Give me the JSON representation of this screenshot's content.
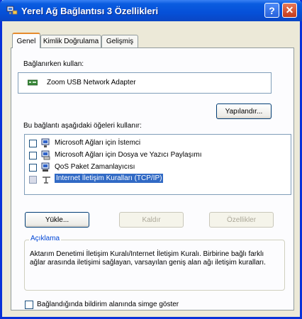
{
  "window": {
    "title": "Yerel Ağ Bağlantısı 3 Özellikleri",
    "help_label": "?",
    "close_label": "✕"
  },
  "tabs": [
    {
      "label": "Genel",
      "active": true
    },
    {
      "label": "Kimlik Doğrulama",
      "active": false
    },
    {
      "label": "Gelişmiş",
      "active": false
    }
  ],
  "connect_using": {
    "label": "Bağlanırken kullan:",
    "adapter": "Zoom USB Network Adapter",
    "configure_button": "Yapılandır..."
  },
  "components": {
    "label": "Bu bağlantı aşağıdaki öğeleri kullanır:",
    "items": [
      {
        "label": "Microsoft Ağları için İstemci",
        "checked": false,
        "icon": "network-client-icon"
      },
      {
        "label": "Microsoft Ağları için Dosya ve Yazıcı Paylaşımı",
        "checked": false,
        "icon": "file-printer-sharing-icon"
      },
      {
        "label": "QoS Paket Zamanlayıcısı",
        "checked": false,
        "icon": "qos-scheduler-icon"
      },
      {
        "label": "Internet İletişim Kuralları (TCP/IP)",
        "checked": false,
        "icon": "protocol-icon",
        "selected": true
      }
    ]
  },
  "buttons": {
    "install": "Yükle...",
    "uninstall": "Kaldır",
    "properties": "Özellikler"
  },
  "description": {
    "title": "Açıklama",
    "text": "Aktarım Denetimi İletişim Kuralı/Internet İletişim Kuralı. Birbirine bağlı farklı ağlar arasında iletişimi sağlayan, varsayılan geniş alan ağı iletişim kuralları."
  },
  "footer": {
    "show_icon_label": "Bağlandığında bildirim alanında simge göster",
    "checked": false
  },
  "colors": {
    "titlebar": "#0550d8",
    "selection": "#316ac5",
    "close": "#c43a1b",
    "tab_highlight": "#e68b2c"
  }
}
